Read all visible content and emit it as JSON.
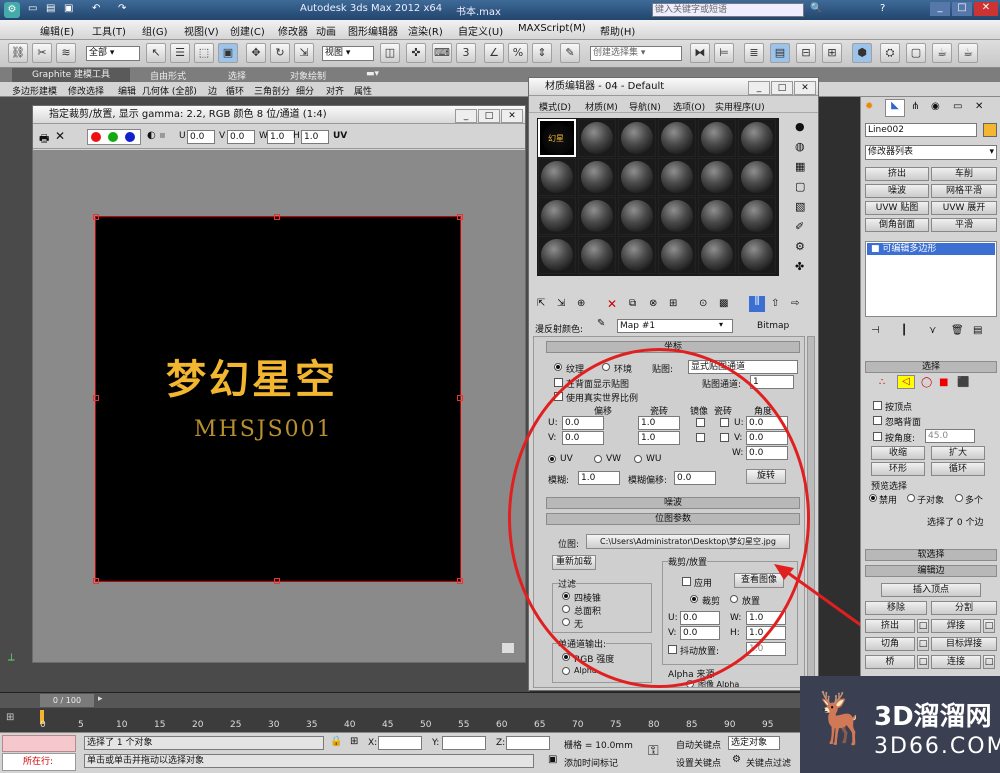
{
  "app_title": "Autodesk 3ds Max  2012 x64",
  "file_name": "书本.max",
  "search_placeholder": "键入关键字或短语",
  "menus": [
    "编辑(E)",
    "工具(T)",
    "组(G)",
    "视图(V)",
    "创建(C)",
    "修改器",
    "动画",
    "图形编辑器",
    "渲染(R)",
    "自定义(U)",
    "MAXScript(M)",
    "帮助(H)"
  ],
  "toolbar": {
    "selection_filter": "全部",
    "ref_coord": "视图",
    "named_selection": "创建选择集"
  },
  "ribbon": {
    "tabs": [
      "Graphite 建模工具",
      "自由形式",
      "选择",
      "对象绘制"
    ],
    "items": [
      "多边形建模",
      "修改选择",
      "编辑",
      "几何体 (全部)",
      "边",
      "循环",
      "三角剖分",
      "细分",
      "对齐",
      "属性"
    ]
  },
  "crop_window": {
    "title": "指定裁剪/放置, 显示 gamma: 2.2, RGB 颜色 8 位/通道 (1:4)",
    "fields": [
      {
        "label": "U",
        "value": "0.0"
      },
      {
        "label": "V",
        "value": "0.0"
      },
      {
        "label": "W",
        "value": "1.0"
      },
      {
        "label": "H",
        "value": "1.0"
      }
    ],
    "uv": "UV",
    "image_title": "梦幻星空",
    "image_subtitle": "MHSJS001"
  },
  "material_editor": {
    "title": "材质编辑器 - 04 - Default",
    "menus": [
      "模式(D)",
      "材质(M)",
      "导航(N)",
      "选项(O)",
      "实用程序(U)"
    ],
    "slot_label": "幻星",
    "diffuse_label": "漫反射颜色:",
    "map_name": "Map #1",
    "map_type": "Bitmap",
    "coords": {
      "header": "坐标",
      "texture": "纹理",
      "env": "环境",
      "mapping_label": "贴图:",
      "mapping_value": "显式贴图通道",
      "show_back": "在背面显示贴图",
      "channel_label": "贴图通道:",
      "channel_value": "1",
      "real_world": "使用真实世界比例",
      "cols": [
        "偏移",
        "瓷砖",
        "镜像",
        "瓷砖",
        "角度"
      ],
      "rows": [
        {
          "label": "U:",
          "offset": "0.0",
          "tile": "1.0",
          "angle_label": "U:",
          "angle": "0.0"
        },
        {
          "label": "V:",
          "offset": "0.0",
          "tile": "1.0",
          "angle_label": "V:",
          "angle": "0.0"
        }
      ],
      "w_label": "W:",
      "w_angle": "0.0",
      "uvw": [
        "UV",
        "VW",
        "WU"
      ],
      "blur_label": "模糊:",
      "blur": "1.0",
      "blur_offset_label": "模糊偏移:",
      "blur_offset": "0.0",
      "rotate": "旋转"
    },
    "noise_header": "噪波",
    "bitmap": {
      "header": "位图参数",
      "path_label": "位图:",
      "path": "C:\\Users\\Administrator\\Desktop\\梦幻星空.jpg",
      "reload": "重新加载",
      "crop_group": "裁剪/放置",
      "apply": "应用",
      "view_image": "查看图像",
      "crop": "裁剪",
      "place": "放置",
      "filter_group": "过滤",
      "filters": [
        "四棱锥",
        "总面积",
        "无"
      ],
      "mono_group": "单通道输出:",
      "mono": [
        "RGB 强度",
        "Alpha"
      ],
      "uv_fields": [
        {
          "label": "U:",
          "value": "0.0"
        },
        {
          "label": "W:",
          "value": "1.0"
        },
        {
          "label": "V:",
          "value": "0.0"
        },
        {
          "label": "H:",
          "value": "1.0"
        }
      ],
      "jitter": "抖动放置:",
      "jitter_value": "1.0",
      "alpha_source": "Alpha 来源",
      "image_alpha": "图像 Alpha"
    }
  },
  "command_panel": {
    "object_name": "Line002",
    "modifier_list": "修改器列表",
    "buttons": [
      "挤出",
      "车削",
      "噪波",
      "网格平滑",
      "UVW 贴图",
      "UVW 展开",
      "倒角剖面",
      "平滑"
    ],
    "stack_item": "可编辑多边形",
    "select_header": "选择",
    "by_vertex": "按顶点",
    "ignore_back": "忽略背面",
    "by_angle": "按角度:",
    "angle_value": "45.0",
    "shrink": "收缩",
    "grow": "扩大",
    "ring": "环形",
    "loop": "循环",
    "preview": "预览选择",
    "preview_opts": [
      "禁用",
      "子对象",
      "多个"
    ],
    "selected_info": "选择了 0 个边",
    "soft_select": "软选择",
    "edit_edges": "编辑边",
    "insert_vertex": "插入顶点",
    "remove": "移除",
    "split": "分割",
    "extrude": "挤出",
    "weld": "焊接",
    "chamfer": "切角",
    "target_weld": "目标焊接",
    "bridge": "桥",
    "connect": "连接"
  },
  "timeline": {
    "counter": "0 / 100",
    "ticks": [
      "0",
      "5",
      "10",
      "15",
      "20",
      "25",
      "30",
      "35",
      "40",
      "45",
      "50",
      "55",
      "60",
      "65",
      "70",
      "75",
      "80",
      "85",
      "90",
      "95"
    ]
  },
  "status": {
    "location": "所在行:",
    "selected": "选择了 1 个对象",
    "prompt": "单击或单击并拖动以选择对象",
    "x": "X:",
    "y": "Y:",
    "z": "Z:",
    "grid": "栅格 = 10.0mm",
    "add_time_tag": "添加时间标记",
    "auto_key": "自动关键点",
    "selected_obj": "选定对象",
    "set_key": "设置关键点",
    "key_filters": "关键点过滤",
    "brand_cn": "3D溜溜网",
    "brand_url": "3D66.COM"
  },
  "colors": {
    "accent_red": "#e02020",
    "stack_blue": "#3b6fd1",
    "brand_bg": "#3a3f52"
  }
}
